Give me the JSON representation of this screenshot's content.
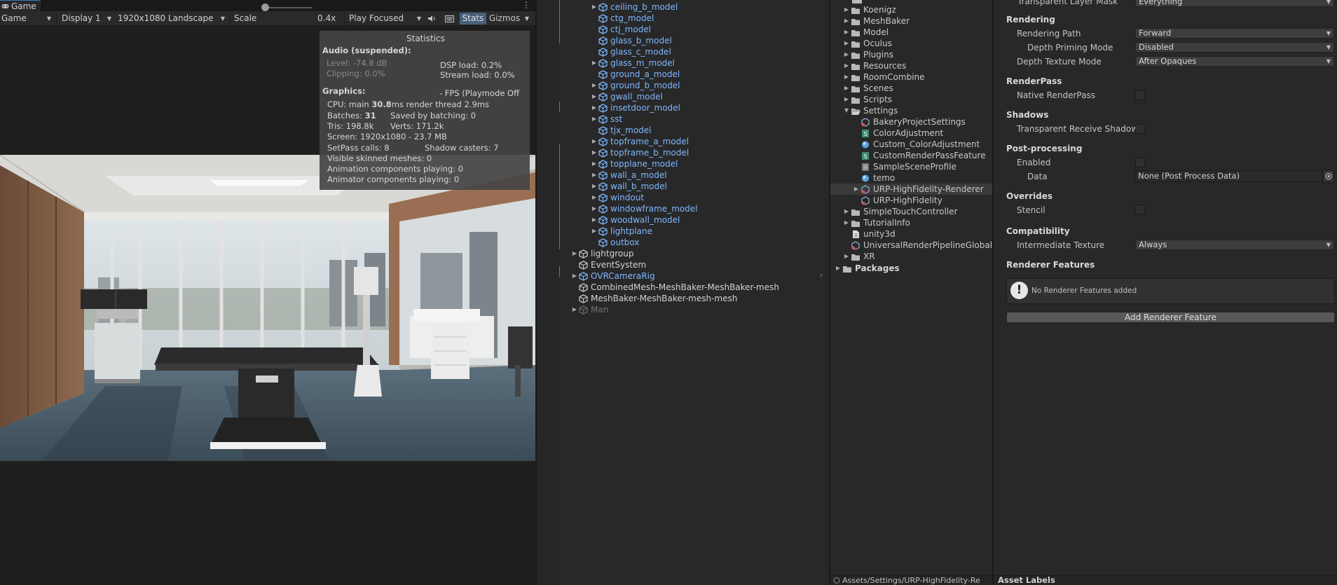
{
  "game": {
    "tab_label": "Game",
    "panel_menu": "⋮",
    "toolbar": {
      "mode": "Game",
      "display": "Display 1",
      "resolution": "1920x1080 Landscape",
      "scale_label": "Scale",
      "scale_value": "0.4x",
      "scale_slider_level": 0.05,
      "play_mode": "Play Focused",
      "stats_label": "Stats",
      "gizmos_label": "Gizmos"
    },
    "stats": {
      "title": "Statistics",
      "audio_header": "Audio (suspended):",
      "level": "Level: -74.8 dB",
      "clipping": "Clipping: 0.0%",
      "dsp_load": "DSP load: 0.2%",
      "stream_load": "Stream load: 0.0%",
      "graphics_header": "Graphics:",
      "fps": "- FPS (Playmode Off",
      "cpu_prefix": "CPU: main",
      "cpu_main": "30.8",
      "cpu_suffix": "ms  render thread 2.9ms",
      "batches_prefix": "Batches:",
      "batches_value": "31",
      "saved_by_batching": "Saved by batching: 0",
      "tris": "Tris: 198.8k",
      "verts": "Verts: 171.2k",
      "screen": "Screen: 1920x1080 - 23.7 MB",
      "setpass": "SetPass calls: 8",
      "shadow_casters": "Shadow casters: 7",
      "visible_skinned": "Visible skinned meshes: 0",
      "animation_components": "Animation components playing: 0",
      "animator_components": "Animator components playing: 0"
    }
  },
  "hierarchy": {
    "items": [
      {
        "label": "ceiling_b_model",
        "expandable": true,
        "style": "blue"
      },
      {
        "label": "ctg_model",
        "expandable": false,
        "style": "blue"
      },
      {
        "label": "ctj_model",
        "expandable": false,
        "style": "blue"
      },
      {
        "label": "glass_b_model",
        "expandable": false,
        "style": "blue"
      },
      {
        "label": "glass_c_model",
        "expandable": false,
        "style": "blue"
      },
      {
        "label": "glass_m_model",
        "expandable": true,
        "style": "blue"
      },
      {
        "label": "ground_a_model",
        "expandable": false,
        "style": "blue"
      },
      {
        "label": "ground_b_model",
        "expandable": true,
        "style": "blue"
      },
      {
        "label": "gwall_model",
        "expandable": true,
        "style": "blue"
      },
      {
        "label": "insetdoor_model",
        "expandable": true,
        "style": "blue"
      },
      {
        "label": "sst",
        "expandable": true,
        "style": "blue"
      },
      {
        "label": "tjx_model",
        "expandable": false,
        "style": "blue"
      },
      {
        "label": "topframe_a_model",
        "expandable": true,
        "style": "blue"
      },
      {
        "label": "topframe_b_model",
        "expandable": true,
        "style": "blue"
      },
      {
        "label": "topplane_model",
        "expandable": true,
        "style": "blue"
      },
      {
        "label": "wall_a_model",
        "expandable": true,
        "style": "blue"
      },
      {
        "label": "wall_b_model",
        "expandable": true,
        "style": "blue"
      },
      {
        "label": "windout",
        "expandable": true,
        "style": "blue"
      },
      {
        "label": "windowframe_model",
        "expandable": true,
        "style": "blue"
      },
      {
        "label": "woodwall_model",
        "expandable": true,
        "style": "blue"
      },
      {
        "label": "lightplane",
        "expandable": true,
        "style": "blue"
      },
      {
        "label": "outbox",
        "expandable": false,
        "style": "blue"
      }
    ],
    "root_items": [
      {
        "label": "lightgroup",
        "expandable": true,
        "style": "white"
      },
      {
        "label": "EventSystem",
        "expandable": false,
        "style": "white"
      },
      {
        "label": "OVRCameraRig",
        "expandable": true,
        "style": "blue"
      },
      {
        "label": "CombinedMesh-MeshBaker-MeshBaker-mesh",
        "expandable": false,
        "style": "white"
      },
      {
        "label": "MeshBaker-MeshBaker-mesh-mesh",
        "expandable": false,
        "style": "white"
      },
      {
        "label": "Man",
        "expandable": true,
        "style": "greyed"
      }
    ],
    "scroll_arrow": "›"
  },
  "project": {
    "items": [
      {
        "label": "Koenigz",
        "type": "folder",
        "indent": 0,
        "expandable": true
      },
      {
        "label": "MeshBaker",
        "type": "folder",
        "indent": 0,
        "expandable": true
      },
      {
        "label": "Model",
        "type": "folder",
        "indent": 0,
        "expandable": true
      },
      {
        "label": "Oculus",
        "type": "folder",
        "indent": 0,
        "expandable": true
      },
      {
        "label": "Plugins",
        "type": "folder",
        "indent": 0,
        "expandable": true
      },
      {
        "label": "Resources",
        "type": "folder",
        "indent": 0,
        "expandable": true
      },
      {
        "label": "RoomCombine",
        "type": "folder",
        "indent": 0,
        "expandable": true
      },
      {
        "label": "Scenes",
        "type": "folder",
        "indent": 0,
        "expandable": true
      },
      {
        "label": "Scripts",
        "type": "folder",
        "indent": 0,
        "expandable": true
      },
      {
        "label": "Settings",
        "type": "folder-open",
        "indent": 0,
        "expandable": true,
        "expanded": true
      },
      {
        "label": "BakeryProjectSettings",
        "type": "asset",
        "indent": 1,
        "expandable": false
      },
      {
        "label": "ColorAdjustment",
        "type": "script",
        "indent": 1,
        "expandable": false
      },
      {
        "label": "Custom_ColorAdjustment",
        "type": "material",
        "indent": 1,
        "expandable": false
      },
      {
        "label": "CustomRenderPassFeature",
        "type": "script",
        "indent": 1,
        "expandable": false
      },
      {
        "label": "SampleSceneProfile",
        "type": "profile",
        "indent": 1,
        "expandable": false
      },
      {
        "label": "temo",
        "type": "material",
        "indent": 1,
        "expandable": false
      },
      {
        "label": "URP-HighFidelity-Renderer",
        "type": "asset",
        "indent": 1,
        "expandable": true,
        "selected": true
      },
      {
        "label": "URP-HighFidelity",
        "type": "asset",
        "indent": 1,
        "expandable": false
      },
      {
        "label": "SimpleTouchController",
        "type": "folder",
        "indent": 0,
        "expandable": true
      },
      {
        "label": "TutorialInfo",
        "type": "folder",
        "indent": 0,
        "expandable": true
      },
      {
        "label": "unity3d",
        "type": "file",
        "indent": 0,
        "expandable": false
      },
      {
        "label": "UniversalRenderPipelineGlobalS",
        "type": "asset",
        "indent": 0,
        "expandable": false
      },
      {
        "label": "XR",
        "type": "folder",
        "indent": 0,
        "expandable": true
      },
      {
        "label": "Packages",
        "type": "folder",
        "indent": -1,
        "expandable": true
      }
    ],
    "path": "Assets/Settings/URP-HighFidelity-Re"
  },
  "inspector": {
    "top_label": "Transparent Layer Mask",
    "top_value": "Everything",
    "rendering_header": "Rendering",
    "rendering_path_label": "Rendering Path",
    "rendering_path_value": "Forward",
    "depth_priming_label": "Depth Priming Mode",
    "depth_priming_value": "Disabled",
    "depth_texture_label": "Depth Texture Mode",
    "depth_texture_value": "After Opaques",
    "renderpass_header": "RenderPass",
    "native_renderpass_label": "Native RenderPass",
    "shadows_header": "Shadows",
    "transparent_receive_label": "Transparent Receive Shadow",
    "postprocessing_header": "Post-processing",
    "enabled_label": "Enabled",
    "data_label": "Data",
    "data_value": "None (Post Process Data)",
    "overrides_header": "Overrides",
    "stencil_label": "Stencil",
    "compat_header": "Compatibility",
    "intermediate_label": "Intermediate Texture",
    "intermediate_value": "Always",
    "features_header": "Renderer Features",
    "no_features": "No Renderer Features added",
    "add_feature": "Add Renderer Feature",
    "asset_labels": "Asset Labels"
  }
}
